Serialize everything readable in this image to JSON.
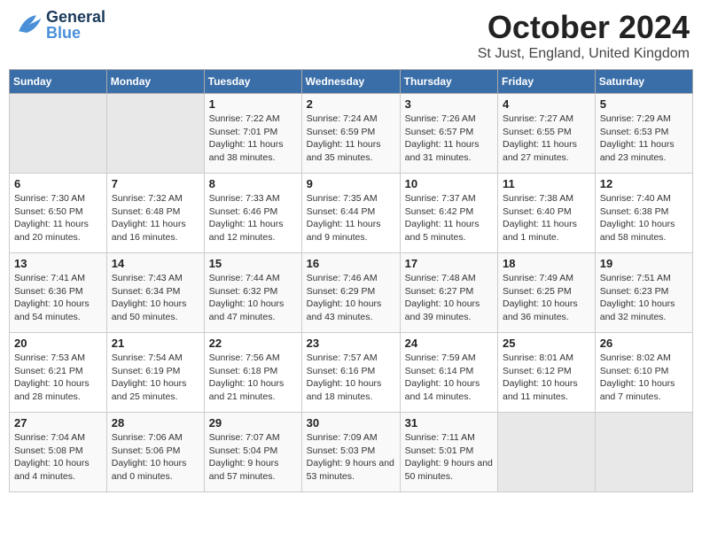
{
  "header": {
    "logo_general": "General",
    "logo_blue": "Blue",
    "month": "October 2024",
    "location": "St Just, England, United Kingdom"
  },
  "weekdays": [
    "Sunday",
    "Monday",
    "Tuesday",
    "Wednesday",
    "Thursday",
    "Friday",
    "Saturday"
  ],
  "weeks": [
    [
      {
        "day": "",
        "sunrise": "",
        "sunset": "",
        "daylight": "",
        "empty": true
      },
      {
        "day": "",
        "sunrise": "",
        "sunset": "",
        "daylight": "",
        "empty": true
      },
      {
        "day": "1",
        "sunrise": "Sunrise: 7:22 AM",
        "sunset": "Sunset: 7:01 PM",
        "daylight": "Daylight: 11 hours and 38 minutes."
      },
      {
        "day": "2",
        "sunrise": "Sunrise: 7:24 AM",
        "sunset": "Sunset: 6:59 PM",
        "daylight": "Daylight: 11 hours and 35 minutes."
      },
      {
        "day": "3",
        "sunrise": "Sunrise: 7:26 AM",
        "sunset": "Sunset: 6:57 PM",
        "daylight": "Daylight: 11 hours and 31 minutes."
      },
      {
        "day": "4",
        "sunrise": "Sunrise: 7:27 AM",
        "sunset": "Sunset: 6:55 PM",
        "daylight": "Daylight: 11 hours and 27 minutes."
      },
      {
        "day": "5",
        "sunrise": "Sunrise: 7:29 AM",
        "sunset": "Sunset: 6:53 PM",
        "daylight": "Daylight: 11 hours and 23 minutes."
      }
    ],
    [
      {
        "day": "6",
        "sunrise": "Sunrise: 7:30 AM",
        "sunset": "Sunset: 6:50 PM",
        "daylight": "Daylight: 11 hours and 20 minutes."
      },
      {
        "day": "7",
        "sunrise": "Sunrise: 7:32 AM",
        "sunset": "Sunset: 6:48 PM",
        "daylight": "Daylight: 11 hours and 16 minutes."
      },
      {
        "day": "8",
        "sunrise": "Sunrise: 7:33 AM",
        "sunset": "Sunset: 6:46 PM",
        "daylight": "Daylight: 11 hours and 12 minutes."
      },
      {
        "day": "9",
        "sunrise": "Sunrise: 7:35 AM",
        "sunset": "Sunset: 6:44 PM",
        "daylight": "Daylight: 11 hours and 9 minutes."
      },
      {
        "day": "10",
        "sunrise": "Sunrise: 7:37 AM",
        "sunset": "Sunset: 6:42 PM",
        "daylight": "Daylight: 11 hours and 5 minutes."
      },
      {
        "day": "11",
        "sunrise": "Sunrise: 7:38 AM",
        "sunset": "Sunset: 6:40 PM",
        "daylight": "Daylight: 11 hours and 1 minute."
      },
      {
        "day": "12",
        "sunrise": "Sunrise: 7:40 AM",
        "sunset": "Sunset: 6:38 PM",
        "daylight": "Daylight: 10 hours and 58 minutes."
      }
    ],
    [
      {
        "day": "13",
        "sunrise": "Sunrise: 7:41 AM",
        "sunset": "Sunset: 6:36 PM",
        "daylight": "Daylight: 10 hours and 54 minutes."
      },
      {
        "day": "14",
        "sunrise": "Sunrise: 7:43 AM",
        "sunset": "Sunset: 6:34 PM",
        "daylight": "Daylight: 10 hours and 50 minutes."
      },
      {
        "day": "15",
        "sunrise": "Sunrise: 7:44 AM",
        "sunset": "Sunset: 6:32 PM",
        "daylight": "Daylight: 10 hours and 47 minutes."
      },
      {
        "day": "16",
        "sunrise": "Sunrise: 7:46 AM",
        "sunset": "Sunset: 6:29 PM",
        "daylight": "Daylight: 10 hours and 43 minutes."
      },
      {
        "day": "17",
        "sunrise": "Sunrise: 7:48 AM",
        "sunset": "Sunset: 6:27 PM",
        "daylight": "Daylight: 10 hours and 39 minutes."
      },
      {
        "day": "18",
        "sunrise": "Sunrise: 7:49 AM",
        "sunset": "Sunset: 6:25 PM",
        "daylight": "Daylight: 10 hours and 36 minutes."
      },
      {
        "day": "19",
        "sunrise": "Sunrise: 7:51 AM",
        "sunset": "Sunset: 6:23 PM",
        "daylight": "Daylight: 10 hours and 32 minutes."
      }
    ],
    [
      {
        "day": "20",
        "sunrise": "Sunrise: 7:53 AM",
        "sunset": "Sunset: 6:21 PM",
        "daylight": "Daylight: 10 hours and 28 minutes."
      },
      {
        "day": "21",
        "sunrise": "Sunrise: 7:54 AM",
        "sunset": "Sunset: 6:19 PM",
        "daylight": "Daylight: 10 hours and 25 minutes."
      },
      {
        "day": "22",
        "sunrise": "Sunrise: 7:56 AM",
        "sunset": "Sunset: 6:18 PM",
        "daylight": "Daylight: 10 hours and 21 minutes."
      },
      {
        "day": "23",
        "sunrise": "Sunrise: 7:57 AM",
        "sunset": "Sunset: 6:16 PM",
        "daylight": "Daylight: 10 hours and 18 minutes."
      },
      {
        "day": "24",
        "sunrise": "Sunrise: 7:59 AM",
        "sunset": "Sunset: 6:14 PM",
        "daylight": "Daylight: 10 hours and 14 minutes."
      },
      {
        "day": "25",
        "sunrise": "Sunrise: 8:01 AM",
        "sunset": "Sunset: 6:12 PM",
        "daylight": "Daylight: 10 hours and 11 minutes."
      },
      {
        "day": "26",
        "sunrise": "Sunrise: 8:02 AM",
        "sunset": "Sunset: 6:10 PM",
        "daylight": "Daylight: 10 hours and 7 minutes."
      }
    ],
    [
      {
        "day": "27",
        "sunrise": "Sunrise: 7:04 AM",
        "sunset": "Sunset: 5:08 PM",
        "daylight": "Daylight: 10 hours and 4 minutes."
      },
      {
        "day": "28",
        "sunrise": "Sunrise: 7:06 AM",
        "sunset": "Sunset: 5:06 PM",
        "daylight": "Daylight: 10 hours and 0 minutes."
      },
      {
        "day": "29",
        "sunrise": "Sunrise: 7:07 AM",
        "sunset": "Sunset: 5:04 PM",
        "daylight": "Daylight: 9 hours and 57 minutes."
      },
      {
        "day": "30",
        "sunrise": "Sunrise: 7:09 AM",
        "sunset": "Sunset: 5:03 PM",
        "daylight": "Daylight: 9 hours and 53 minutes."
      },
      {
        "day": "31",
        "sunrise": "Sunrise: 7:11 AM",
        "sunset": "Sunset: 5:01 PM",
        "daylight": "Daylight: 9 hours and 50 minutes."
      },
      {
        "day": "",
        "sunrise": "",
        "sunset": "",
        "daylight": "",
        "empty": true
      },
      {
        "day": "",
        "sunrise": "",
        "sunset": "",
        "daylight": "",
        "empty": true
      }
    ]
  ]
}
